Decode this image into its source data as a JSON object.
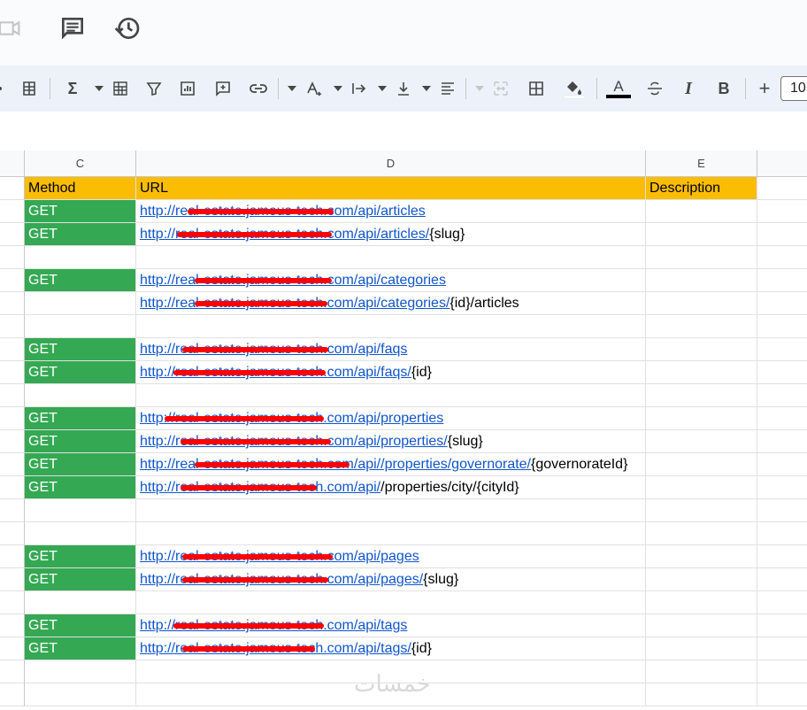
{
  "header": {
    "icons": [
      "video-icon",
      "comment-icon",
      "history-icon"
    ]
  },
  "toolbar": {
    "font_size": "10",
    "text_color": "#000000",
    "icons": [
      "insert-row-icon",
      "sum-icon",
      "pivot-table-icon",
      "filter-icon",
      "chart-icon",
      "comment-add-icon",
      "link-icon",
      "text-rotate-icon",
      "text-wrap-icon",
      "valign-icon",
      "align-icon",
      "merge-icon",
      "borders-icon",
      "fill-color-icon",
      "text-color-icon",
      "strikethrough-icon",
      "italic-icon",
      "bold-icon",
      "plus-icon"
    ]
  },
  "columns": [
    {
      "label": "C"
    },
    {
      "label": "D"
    },
    {
      "label": "E"
    }
  ],
  "sheet": {
    "header": {
      "method": "Method",
      "url": "URL",
      "description": "Description"
    },
    "rows": [
      {
        "method": "GET",
        "url": "http://real-estate.jamous-tech.com/api/articles",
        "suffix": ""
      },
      {
        "method": "GET",
        "url": "http://real-estate.jamous-tech.com/api/articles/",
        "suffix": "{slug}"
      },
      {
        "method": "",
        "url": "",
        "suffix": ""
      },
      {
        "method": "GET",
        "url": "http://real-estate.jamous-tech.com/api/categories",
        "suffix": ""
      },
      {
        "method": "",
        "url": "http://real-estate.jamous-tech.com/api/categories/",
        "suffix": "{id}/articles"
      },
      {
        "method": "",
        "url": "",
        "suffix": ""
      },
      {
        "method": "GET",
        "url": "http://real-estate.jamous-tech.com/api/faqs",
        "suffix": ""
      },
      {
        "method": "GET",
        "url": "http://real-estate.jamous-tech.com/api/faqs/",
        "suffix": "{id}"
      },
      {
        "method": "",
        "url": "",
        "suffix": ""
      },
      {
        "method": "GET",
        "url": "http://real-estate.jamous-tech.com/api/properties",
        "suffix": ""
      },
      {
        "method": "GET",
        "url": "http://real-estate.jamous-tech.com/api/properties/",
        "suffix": "{slug}"
      },
      {
        "method": "GET",
        "url": "http://real-estate.jamous-tech.com/api//properties/governorate/",
        "suffix": "{governorateId}"
      },
      {
        "method": "GET",
        "url": "http://real-estate.jamous-tech.com/api/",
        "suffix": "/properties/city/{cityId}"
      },
      {
        "method": "",
        "url": "",
        "suffix": ""
      },
      {
        "method": "",
        "url": "",
        "suffix": ""
      },
      {
        "method": "GET",
        "url": "http://real-estate.jamous-tech.com/api/pages",
        "suffix": ""
      },
      {
        "method": "GET",
        "url": "http://real-estate.jamous-tech.com/api/pages/",
        "suffix": "{slug}"
      },
      {
        "method": "",
        "url": "",
        "suffix": ""
      },
      {
        "method": "GET",
        "url": "http://real-estate.jamous-tech.com/api/tags",
        "suffix": ""
      },
      {
        "method": "GET",
        "url": "http://real-estate.jamous-tech.com/api/tags/",
        "suffix": "{id}"
      },
      {
        "method": "",
        "url": "",
        "suffix": ""
      },
      {
        "method": "",
        "url": "",
        "suffix": ""
      }
    ]
  },
  "watermark": "خمسات",
  "colors": {
    "header_fill": "#fbbc04",
    "get_fill": "#34a853",
    "link": "#1155cc",
    "redaction": "#ff0000"
  }
}
